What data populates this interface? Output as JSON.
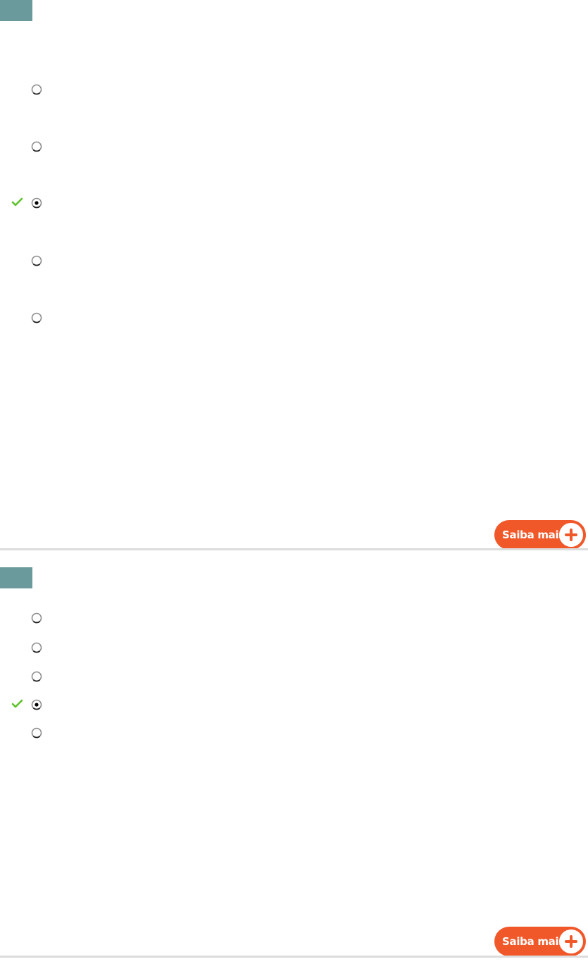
{
  "questions": [
    {
      "options": [
        {
          "selected": false,
          "marked_correct": false
        },
        {
          "selected": false,
          "marked_correct": false
        },
        {
          "selected": true,
          "marked_correct": true
        },
        {
          "selected": false,
          "marked_correct": false
        },
        {
          "selected": false,
          "marked_correct": false
        }
      ],
      "saiba_mais_label": "Saiba mais"
    },
    {
      "options": [
        {
          "selected": false,
          "marked_correct": false
        },
        {
          "selected": false,
          "marked_correct": false
        },
        {
          "selected": false,
          "marked_correct": false
        },
        {
          "selected": true,
          "marked_correct": true
        },
        {
          "selected": false,
          "marked_correct": false
        }
      ],
      "saiba_mais_label": "Saiba mais"
    }
  ],
  "colors": {
    "question_number_box": "#6a9a9b",
    "saiba_mais_button": "#f0582a",
    "check_mark": "#5cc22a",
    "divider": "#dcdcdc"
  }
}
